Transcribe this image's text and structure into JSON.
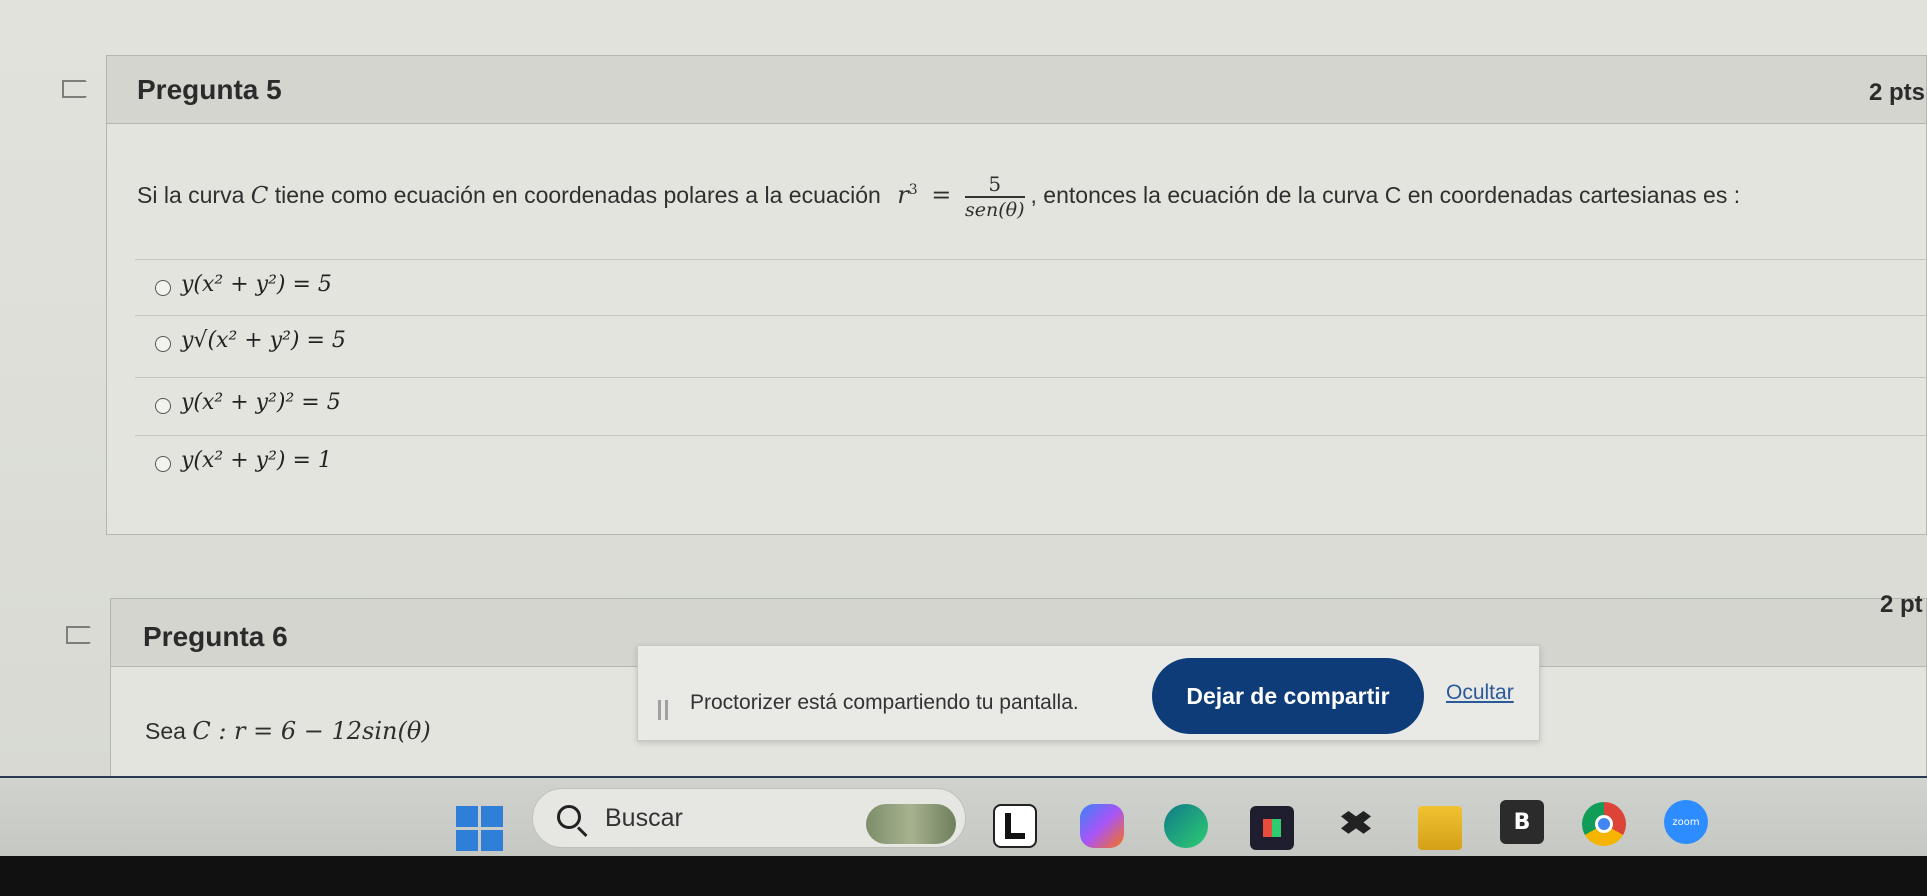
{
  "question5": {
    "title": "Pregunta 5",
    "points": "2 pts",
    "prompt_prefix": "Si la curva",
    "curve_symbol": "C",
    "prompt_middle": "tiene como ecuación en coordenadas polares a la ecuación",
    "equation_lhs": "r",
    "equation_exp": "3",
    "equation_eq": "=",
    "fraction_num": "5",
    "fraction_den": "sen(θ)",
    "prompt_suffix": ", entonces la ecuación de la curva C en coordenadas cartesianas es :",
    "options": [
      {
        "label": "y(x² + y²) = 5"
      },
      {
        "label": "y√(x² + y²) = 5"
      },
      {
        "label": "y(x² + y²)² = 5"
      },
      {
        "label": "y(x² + y²) = 1"
      }
    ]
  },
  "question6": {
    "title": "Pregunta 6",
    "points": "2 pt",
    "prompt_prefix": "Sea",
    "prompt_math": "C : r = 6 − 12sin(θ)"
  },
  "share_bar": {
    "message": "Proctorizer está compartiendo tu pantalla.",
    "stop_label": "Dejar de compartir",
    "hide_label": "Ocultar"
  },
  "taskbar": {
    "search_label": "Buscar",
    "icons": [
      "windows-start-icon",
      "weather-widget-icon",
      "app-l-icon",
      "copilot-icon",
      "edge-icon",
      "store-icon",
      "dropbox-icon",
      "file-explorer-icon",
      "b-app-icon",
      "chrome-icon",
      "zoom-icon"
    ],
    "zoom_text": "zoom",
    "b_text": "B"
  },
  "colors": {
    "accent": "#0d3c78",
    "link": "#2a5a9a"
  }
}
